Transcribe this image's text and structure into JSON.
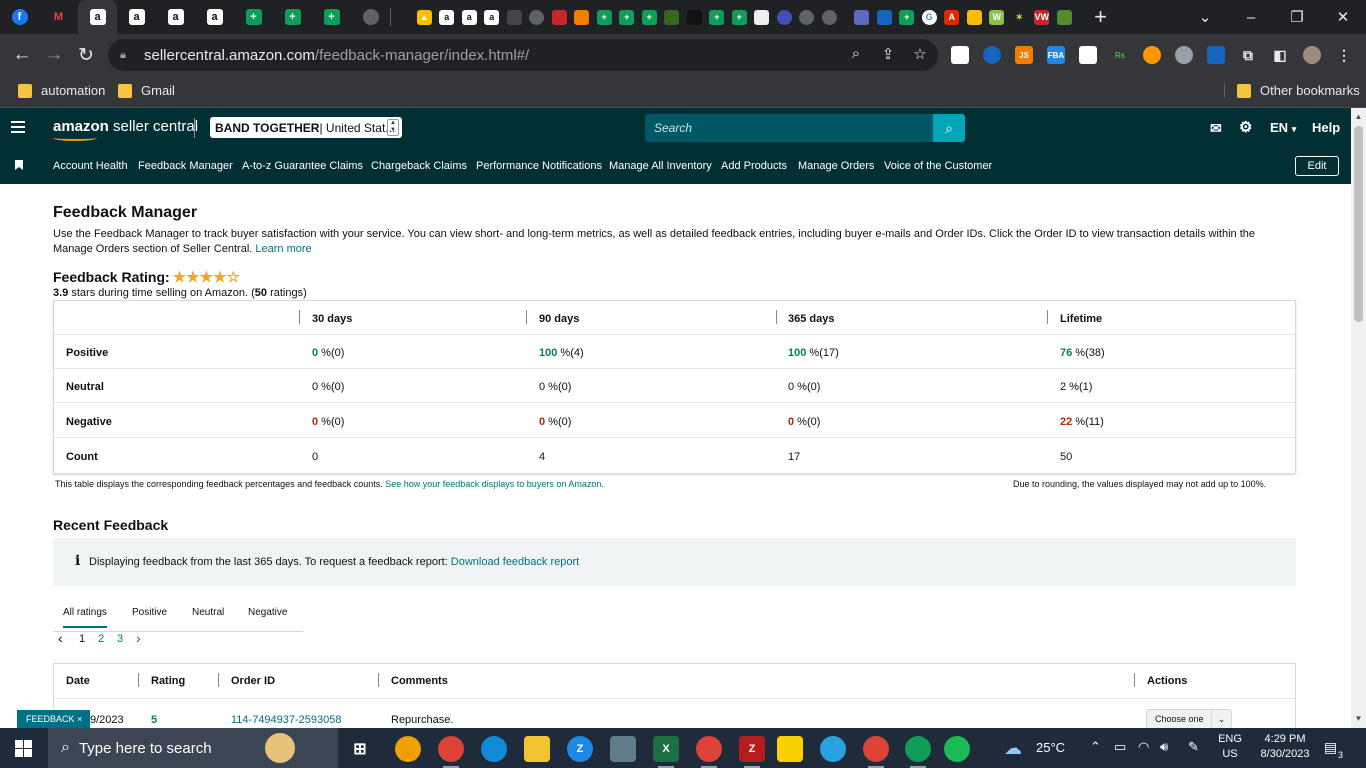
{
  "browser": {
    "url_host": "sellercentral.amazon.com",
    "url_path": "/feedback-manager/index.html#/",
    "bookmarks": [
      "automation",
      "Gmail"
    ],
    "other_bookmarks": "Other bookmarks",
    "lock_icon": "lock-icon"
  },
  "header": {
    "logo_prefix": "amazon",
    "logo_suffix": " seller central",
    "store_name": "BAND TOGETHER",
    "store_region": " | United Stat...",
    "search_placeholder": "Search",
    "language": "EN",
    "language_caret": "▾",
    "help": "Help"
  },
  "nav": {
    "items": [
      "Account Health",
      "Feedback Manager",
      "A-to-z Guarantee Claims",
      "Chargeback Claims",
      "Performance Notifications",
      "Manage All Inventory",
      "Add Products",
      "Manage Orders",
      "Voice of the Customer"
    ],
    "edit": "Edit"
  },
  "page": {
    "title": "Feedback Manager",
    "intro": "Use the Feedback Manager to track buyer satisfaction with your service. You can view short- and long-term metrics, as well as detailed feedback entries, including buyer e-mails and Order IDs. Click the Order ID to view transaction details within the Manage Orders section of Seller Central. ",
    "learn_more": "Learn more",
    "rating_label": "Feedback Rating:",
    "rating_value": 3.9,
    "rating_stars_shown": 4,
    "rating_value_text": "3.9",
    "rating_mid": " stars during time selling on Amazon. (",
    "rating_count": "50",
    "rating_tail": " ratings)"
  },
  "feedback_table": {
    "columns": [
      "30 days",
      "90 days",
      "365 days",
      "Lifetime"
    ],
    "rows": [
      {
        "label": "Positive",
        "cells": [
          {
            "v": "0",
            "u": " %(0)"
          },
          {
            "v": "100",
            "u": " %(4)"
          },
          {
            "v": "100",
            "u": " %(17)"
          },
          {
            "v": "76",
            "u": " %(38)"
          }
        ]
      },
      {
        "label": "Neutral",
        "cells": [
          {
            "v": "0",
            "u": " %(0)"
          },
          {
            "v": "0",
            "u": " %(0)"
          },
          {
            "v": "0",
            "u": " %(0)"
          },
          {
            "v": "2",
            "u": " %(1)"
          }
        ]
      },
      {
        "label": "Negative",
        "cells": [
          {
            "v": "0",
            "u": " %(0)"
          },
          {
            "v": "0",
            "u": " %(0)"
          },
          {
            "v": "0",
            "u": " %(0)"
          },
          {
            "v": "22",
            "u": " %(11)"
          }
        ]
      },
      {
        "label": "Count",
        "cells": [
          {
            "v": "0",
            "u": ""
          },
          {
            "v": "4",
            "u": ""
          },
          {
            "v": "17",
            "u": ""
          },
          {
            "v": "50",
            "u": ""
          }
        ]
      }
    ],
    "footnote": "This table displays the corresponding feedback percentages and feedback counts. ",
    "footnote_link": "See how your feedback displays to buyers on Amazon.",
    "rounding_note": "Due to rounding, the values displayed may not add up to 100%."
  },
  "recent": {
    "title": "Recent Feedback",
    "info": "Displaying feedback from the last 365 days. To request a feedback report: ",
    "info_link": "Download feedback report",
    "tabs": [
      "All ratings",
      "Positive",
      "Neutral",
      "Negative"
    ],
    "pages": [
      "1",
      "2",
      "3"
    ],
    "prev": "‹",
    "next": "›",
    "columns": [
      "Date",
      "Rating",
      "Order ID",
      "Comments",
      "Actions"
    ],
    "rows": [
      {
        "date": "9/2023",
        "rating": "5",
        "order_id": "114-7494937-2593058",
        "comment": "Repurchase.",
        "action": "Choose one"
      }
    ]
  },
  "feedback_widget": "FEEDBACK ×",
  "taskbar": {
    "search_placeholder": "Type here to search",
    "temperature": "25°C",
    "lang_top": "ENG",
    "lang_bottom": "US",
    "time": "4:29 PM",
    "date": "8/30/2023",
    "notifications": "3"
  },
  "colors": {
    "header_bg": "#002f36",
    "accent": "#007185",
    "positive": "#067d62",
    "negative": "#b12704"
  }
}
